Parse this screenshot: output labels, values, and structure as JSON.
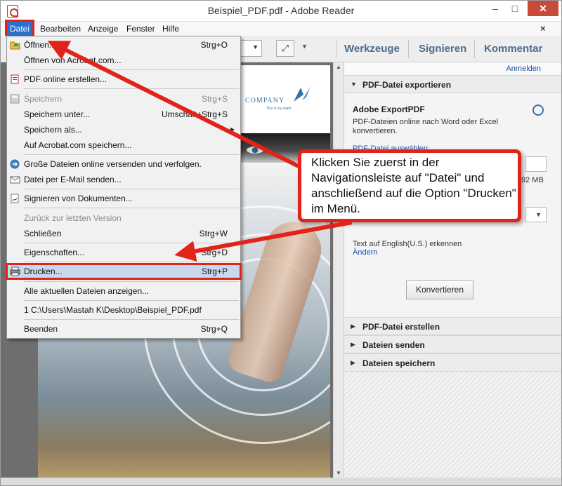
{
  "window": {
    "title": "Beispiel_PDF.pdf - Adobe Reader",
    "controls": {
      "minimize": "–",
      "maximize": "□",
      "close": "✕"
    }
  },
  "menubar": {
    "items": [
      "Datei",
      "Bearbeiten",
      "Anzeige",
      "Fenster",
      "Hilfe"
    ],
    "close": "×"
  },
  "toolbar": {
    "tabs": [
      "Werkzeuge",
      "Signieren",
      "Kommentar"
    ]
  },
  "file_menu": {
    "items": [
      {
        "label": "Öffnen...",
        "shortcut": "Strg+O",
        "icon": "open-folder-icon"
      },
      {
        "label": "Öffnen von Acrobat.com...",
        "shortcut": ""
      },
      {
        "label": "PDF online erstellen...",
        "shortcut": "",
        "icon": "pdf-create-icon"
      },
      {
        "label": "Speichern",
        "shortcut": "Strg+S",
        "disabled": true,
        "icon": "save-icon"
      },
      {
        "label": "Speichern unter...",
        "shortcut": "Umschalt+Strg+S"
      },
      {
        "label": "Speichern als...",
        "shortcut": "",
        "submenu": true
      },
      {
        "label": "Auf Acrobat.com speichern...",
        "shortcut": ""
      },
      {
        "label": "Große Dateien online versenden und verfolgen.",
        "shortcut": "",
        "icon": "send-files-icon"
      },
      {
        "label": "Datei per E-Mail senden...",
        "shortcut": "",
        "icon": "email-icon"
      },
      {
        "label": "Signieren von Dokumenten...",
        "shortcut": "",
        "icon": "sign-icon"
      },
      {
        "label": "Zurück zur letzten Version",
        "shortcut": "",
        "disabled": true
      },
      {
        "label": "Schließen",
        "shortcut": "Strg+W"
      },
      {
        "label": "Eigenschaften...",
        "shortcut": "Strg+D"
      },
      {
        "label": "Drucken...",
        "shortcut": "Strg+P",
        "icon": "printer-icon"
      },
      {
        "label": "Alle aktuellen Dateien anzeigen...",
        "shortcut": ""
      },
      {
        "label": "1 C:\\Users\\Mastah K\\Desktop\\Beispiel_PDF.pdf",
        "shortcut": ""
      },
      {
        "label": "Beenden",
        "shortcut": "Strg+Q"
      }
    ]
  },
  "document": {
    "company": "COMPANY",
    "company_sub": "This is my claim"
  },
  "right_panel": {
    "anmelden": "Anmelden",
    "export_section": "PDF-Datei exportieren",
    "export_title": "Adobe ExportPDF",
    "export_desc": "PDF-Dateien online nach Word oder Excel konvertieren.",
    "select_label": "PDF-Datei auswählen:",
    "file_size": "92 MB",
    "lang_text": "Text auf English(U.S.) erkennen",
    "change_link": "Ändern",
    "convert_button": "Konvertieren",
    "sections": [
      "PDF-Datei erstellen",
      "Dateien senden",
      "Dateien speichern"
    ]
  },
  "callout": {
    "text": "Klicken Sie zuerst in der Navigationsleiste auf \"Datei\" und anschließend auf die Option \"Drucken\" im Menü."
  },
  "colors": {
    "highlight_red": "#e2231a",
    "menu_selected": "#2a6fc9",
    "link_blue": "#1f4fa3",
    "tab_blue": "#4b6c8f"
  }
}
